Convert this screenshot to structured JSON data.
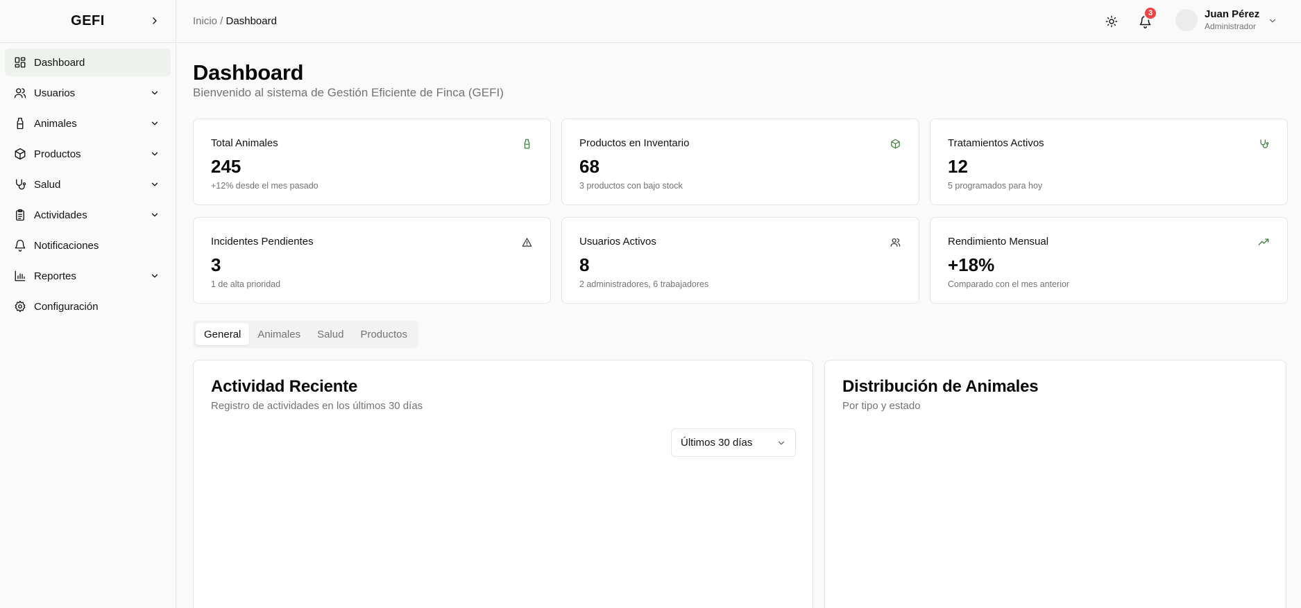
{
  "app": {
    "logo": "GEFI"
  },
  "sidebar": {
    "items": [
      {
        "label": "Dashboard",
        "icon": "dashboard-icon",
        "active": true,
        "expandable": false
      },
      {
        "label": "Usuarios",
        "icon": "users-icon",
        "expandable": true
      },
      {
        "label": "Animales",
        "icon": "milk-bottle-icon",
        "expandable": true
      },
      {
        "label": "Productos",
        "icon": "package-icon",
        "expandable": true
      },
      {
        "label": "Salud",
        "icon": "stethoscope-icon",
        "expandable": true
      },
      {
        "label": "Actividades",
        "icon": "clipboard-list-icon",
        "expandable": true
      },
      {
        "label": "Notificaciones",
        "icon": "bell-icon",
        "expandable": false
      },
      {
        "label": "Reportes",
        "icon": "bar-chart-icon",
        "expandable": true
      },
      {
        "label": "Configuración",
        "icon": "settings-icon",
        "expandable": false
      }
    ]
  },
  "topbar": {
    "breadcrumb_root": "Inicio",
    "breadcrumb_sep": " / ",
    "breadcrumb_current": "Dashboard",
    "notifications_count": "3",
    "user_name": "Juan Pérez",
    "user_role": "Administrador"
  },
  "page": {
    "title": "Dashboard",
    "subtitle": "Bienvenido al sistema de Gestión Eficiente de Finca (GEFI)"
  },
  "stats": [
    {
      "label": "Total Animales",
      "value": "245",
      "note": "+12% desde el mes pasado",
      "icon": "milk-bottle-icon"
    },
    {
      "label": "Productos en Inventario",
      "value": "68",
      "note": "3 productos con bajo stock",
      "icon": "package-icon"
    },
    {
      "label": "Tratamientos Activos",
      "value": "12",
      "note": "5 programados para hoy",
      "icon": "stethoscope-icon"
    },
    {
      "label": "Incidentes Pendientes",
      "value": "3",
      "note": "1 de alta prioridad",
      "icon": "alert-triangle-icon"
    },
    {
      "label": "Usuarios Activos",
      "value": "8",
      "note": "2 administradores, 6 trabajadores",
      "icon": "users-icon"
    },
    {
      "label": "Rendimiento Mensual",
      "value": "+18%",
      "note": "Comparado con el mes anterior",
      "icon": "trending-up-icon"
    }
  ],
  "tabs": [
    {
      "label": "General",
      "active": true
    },
    {
      "label": "Animales"
    },
    {
      "label": "Salud"
    },
    {
      "label": "Productos"
    }
  ],
  "panels": {
    "activity": {
      "title": "Actividad Reciente",
      "subtitle": "Registro de actividades en los últimos 30 días",
      "range_value": "Últimos 30 días"
    },
    "distribution": {
      "title": "Distribución de Animales",
      "subtitle": "Por tipo y estado"
    }
  },
  "colors": {
    "accent_green": "#3f7d3a",
    "active_bg": "#edf3ec",
    "badge_red": "#ef4444"
  }
}
